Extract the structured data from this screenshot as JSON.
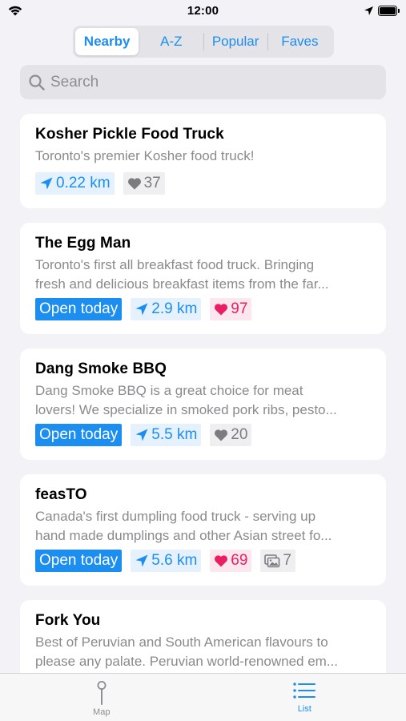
{
  "status_bar": {
    "time": "12:00"
  },
  "segments": [
    {
      "label": "Nearby",
      "active": true
    },
    {
      "label": "A-Z",
      "active": false
    },
    {
      "label": "Popular",
      "active": false
    },
    {
      "label": "Faves",
      "active": false
    }
  ],
  "search": {
    "placeholder": "Search"
  },
  "trucks": [
    {
      "name": "Kosher Pickle Food Truck",
      "description_lines": [
        "Toronto's premier Kosher food truck!"
      ],
      "open_label": "",
      "distance": "0.22 km",
      "likes": "37",
      "likes_style": "gray"
    },
    {
      "name": "The Egg Man",
      "description_lines": [
        "Toronto's first all breakfast food truck. Bringing",
        "fresh and delicious breakfast items from the far..."
      ],
      "open_label": "Open today",
      "distance": "2.9 km",
      "likes": "97",
      "likes_style": "pink"
    },
    {
      "name": "Dang Smoke BBQ",
      "description_lines": [
        "Dang Smoke BBQ is a great choice for meat",
        "lovers! We specialize in smoked pork ribs, pesto..."
      ],
      "open_label": "Open today",
      "distance": "5.5 km",
      "likes": "20",
      "likes_style": "gray"
    },
    {
      "name": "feasTO",
      "description_lines": [
        "Canada's first dumpling food truck - serving up",
        "hand made dumplings and other Asian street fo..."
      ],
      "open_label": "Open today",
      "distance": "5.6 km",
      "likes": "69",
      "likes_style": "pink",
      "photos": "7"
    },
    {
      "name": "Fork You",
      "description_lines": [
        "Best of Peruvian and South American flavours to",
        "please any palate. Peruvian world-renowned em..."
      ]
    }
  ],
  "tabbar": {
    "map_label": "Map",
    "list_label": "List"
  },
  "colors": {
    "accent": "#1c8ef0",
    "pink": "#e91e63",
    "background": "#f2f2f7"
  },
  "icons": {
    "status": [
      "wifi-icon",
      "location-arrow-icon",
      "battery-icon"
    ],
    "search": "search-icon",
    "distance": "location-arrow-icon",
    "likes": "heart-icon",
    "photos": "photos-icon",
    "tabs": [
      "map-pin-icon",
      "list-icon"
    ]
  }
}
